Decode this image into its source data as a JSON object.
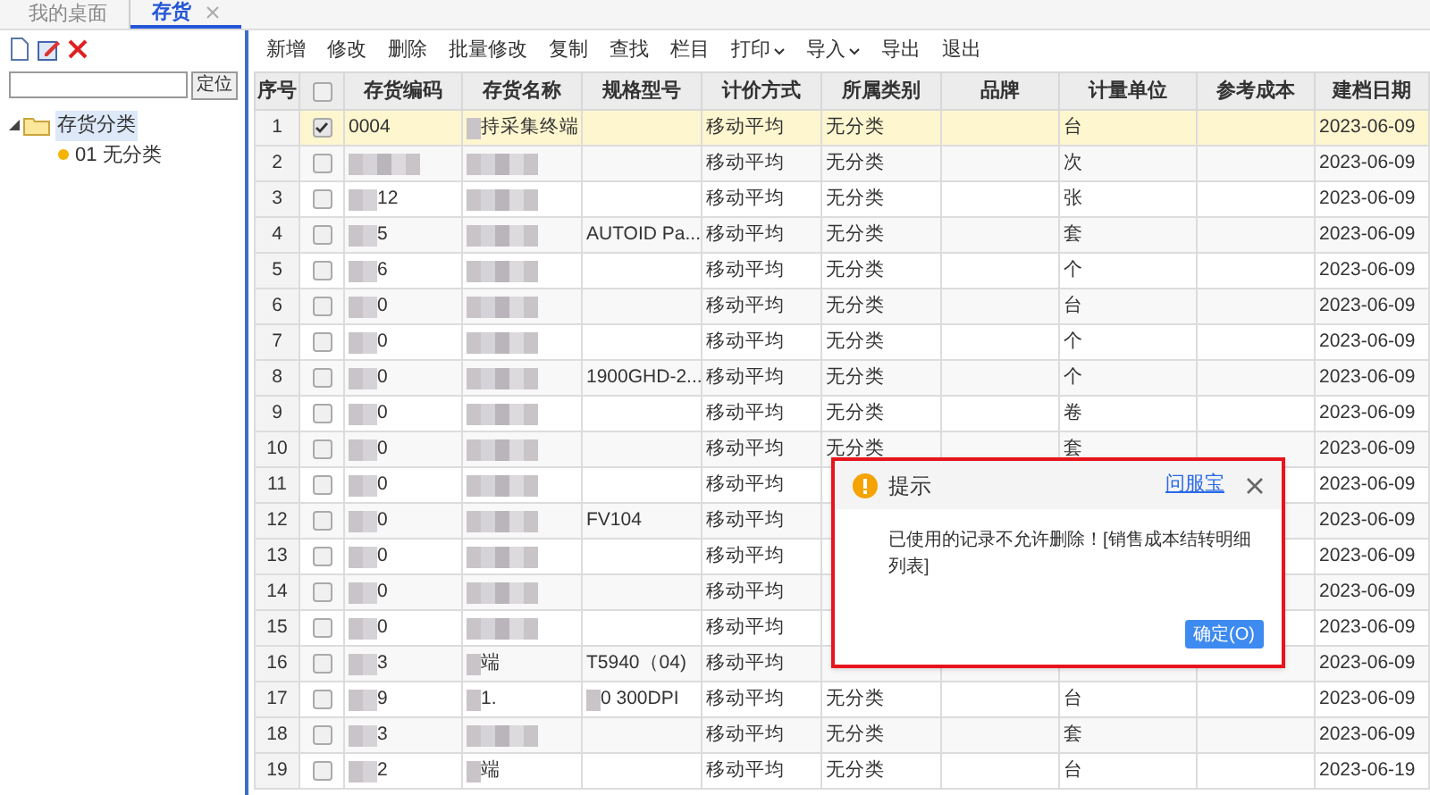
{
  "tabs": [
    {
      "label": "我的桌面",
      "selected": false,
      "closable": false
    },
    {
      "label": "存货",
      "selected": true,
      "closable": true
    }
  ],
  "sidebar": {
    "locate_button": "定位",
    "tree": [
      {
        "label": "存货分类",
        "expanded": true,
        "children": [
          {
            "label": "01 无分类"
          }
        ]
      }
    ]
  },
  "toolbar": [
    {
      "label": "新增",
      "dropdown": false
    },
    {
      "label": "修改",
      "dropdown": false
    },
    {
      "label": "删除",
      "dropdown": false
    },
    {
      "label": "批量修改",
      "dropdown": false
    },
    {
      "label": "复制",
      "dropdown": false
    },
    {
      "label": "查找",
      "dropdown": false
    },
    {
      "label": "栏目",
      "dropdown": false
    },
    {
      "label": "打印",
      "dropdown": true
    },
    {
      "label": "导入",
      "dropdown": true
    },
    {
      "label": "导出",
      "dropdown": false
    },
    {
      "label": "退出",
      "dropdown": false
    }
  ],
  "table": {
    "columns": [
      "序号",
      "存货编码",
      "存货名称",
      "规格型号",
      "计价方式",
      "所属类别",
      "品牌",
      "计量单位",
      "参考成本",
      "建档日期"
    ],
    "header_checkbox": {
      "checked": false
    },
    "rows": [
      {
        "no": "1",
        "checked": true,
        "selected": true,
        "code": "0004",
        "code_blurred": false,
        "name": "持采集终端",
        "name_blurred": true,
        "method": "移动平均",
        "category": "无分类",
        "unit": "台",
        "date": "2023-06-09"
      },
      {
        "no": "2",
        "checked": false,
        "selected": false,
        "code_blurred": true,
        "name_blurred": true,
        "method": "移动平均",
        "category": "无分类",
        "unit": "次",
        "date": "2023-06-09"
      },
      {
        "no": "3",
        "checked": false,
        "selected": false,
        "code": "12",
        "code_blurred": true,
        "name_blurred": true,
        "method": "移动平均",
        "category": "无分类",
        "unit": "张",
        "date": "2023-06-09"
      },
      {
        "no": "4",
        "checked": false,
        "selected": false,
        "code": "5",
        "code_blurred": true,
        "name_blurred": true,
        "spec": "AUTOID Pa...",
        "method": "移动平均",
        "category": "无分类",
        "unit": "套",
        "date": "2023-06-09"
      },
      {
        "no": "5",
        "checked": false,
        "selected": false,
        "code": "6",
        "code_blurred": true,
        "name_blurred": true,
        "method": "移动平均",
        "category": "无分类",
        "unit": "个",
        "date": "2023-06-09"
      },
      {
        "no": "6",
        "checked": false,
        "selected": false,
        "code": "0",
        "code_blurred": true,
        "name_blurred": true,
        "method": "移动平均",
        "category": "无分类",
        "unit": "台",
        "date": "2023-06-09"
      },
      {
        "no": "7",
        "checked": false,
        "selected": false,
        "code": "0",
        "code_blurred": true,
        "name_blurred": true,
        "method": "移动平均",
        "category": "无分类",
        "unit": "个",
        "date": "2023-06-09"
      },
      {
        "no": "8",
        "checked": false,
        "selected": false,
        "code": "0",
        "code_blurred": true,
        "name_blurred": true,
        "spec": "1900GHD-2...",
        "method": "移动平均",
        "category": "无分类",
        "unit": "个",
        "date": "2023-06-09"
      },
      {
        "no": "9",
        "checked": false,
        "selected": false,
        "code": "0",
        "code_blurred": true,
        "name_blurred": true,
        "method": "移动平均",
        "category": "无分类",
        "unit": "卷",
        "date": "2023-06-09"
      },
      {
        "no": "10",
        "checked": false,
        "selected": false,
        "code": "0",
        "code_blurred": true,
        "name_blurred": true,
        "method": "移动平均",
        "category": "无分类",
        "unit": "套",
        "date": "2023-06-09"
      },
      {
        "no": "11",
        "checked": false,
        "selected": false,
        "code": "0",
        "code_blurred": true,
        "name_blurred": true,
        "method": "移动平均",
        "date": "2023-06-09"
      },
      {
        "no": "12",
        "checked": false,
        "selected": false,
        "code": "0",
        "code_blurred": true,
        "name_blurred": true,
        "spec": "FV104",
        "method": "移动平均",
        "date": "2023-06-09"
      },
      {
        "no": "13",
        "checked": false,
        "selected": false,
        "code": "0",
        "code_blurred": true,
        "name_blurred": true,
        "method": "移动平均",
        "date": "2023-06-09"
      },
      {
        "no": "14",
        "checked": false,
        "selected": false,
        "code": "0",
        "code_blurred": true,
        "name_blurred": true,
        "method": "移动平均",
        "date": "2023-06-09"
      },
      {
        "no": "15",
        "checked": false,
        "selected": false,
        "code": "0",
        "code_blurred": true,
        "name_blurred": true,
        "method": "移动平均",
        "date": "2023-06-09"
      },
      {
        "no": "16",
        "checked": false,
        "selected": false,
        "code": "3",
        "code_blurred": true,
        "name": "端",
        "name_blurred": true,
        "spec": "T5940（04)",
        "method": "移动平均",
        "date": "2023-06-09"
      },
      {
        "no": "17",
        "checked": false,
        "selected": false,
        "code": "9",
        "code_blurred": true,
        "name": "1.",
        "name_blurred": true,
        "spec": "0 300DPI",
        "spec_blurred": true,
        "method": "移动平均",
        "category": "无分类",
        "unit": "台",
        "date": "2023-06-09"
      },
      {
        "no": "18",
        "checked": false,
        "selected": false,
        "code": "3",
        "code_blurred": true,
        "name_blurred": true,
        "method": "移动平均",
        "category": "无分类",
        "unit": "套",
        "date": "2023-06-09"
      },
      {
        "no": "19",
        "checked": false,
        "selected": false,
        "code": "2",
        "code_blurred": true,
        "name": "端",
        "name_blurred": true,
        "method": "移动平均",
        "category": "无分类",
        "unit": "台",
        "date": "2023-06-19"
      }
    ]
  },
  "dialog": {
    "title": "提示",
    "link": "问服宝",
    "message": "已使用的记录不允许删除！[销售成本结转明细列表]",
    "ok_button": "确定(O)",
    "highlighted": true
  }
}
